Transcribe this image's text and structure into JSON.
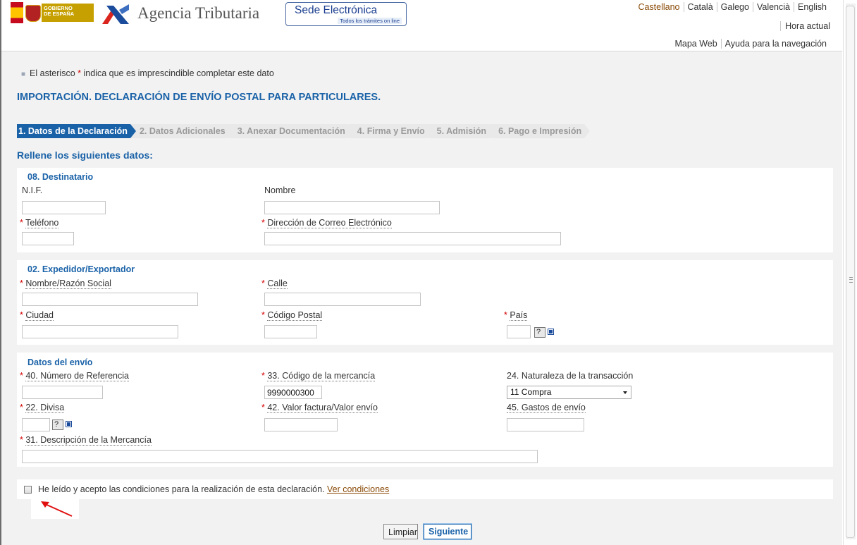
{
  "header": {
    "gov_logo_lines": [
      "GOBIERNO",
      "DE ESPAÑA"
    ],
    "agency_title": "Agencia Tributaria",
    "sede_title": "Sede Electrónica",
    "sede_subtitle": "Todos los trámites on line",
    "languages": [
      "Castellano",
      "Català",
      "Galego",
      "Valencià",
      "English"
    ],
    "hora_actual": "Hora actual",
    "mapa_web": "Mapa Web",
    "ayuda": "Ayuda para la navegación"
  },
  "note": {
    "prefix": "El asterisco",
    "star": "*",
    "suffix": "indica que es imprescindible completar este dato"
  },
  "page_title": "IMPORTACIÓN. DECLARACIÓN DE ENVÍO POSTAL PARA PARTICULARES.",
  "steps": [
    {
      "label": "1. Datos de la Declaración",
      "active": true
    },
    {
      "label": "2. Datos Adicionales",
      "active": false
    },
    {
      "label": "3. Anexar Documentación",
      "active": false
    },
    {
      "label": "4. Firma y Envío",
      "active": false
    },
    {
      "label": "5. Admisión",
      "active": false
    },
    {
      "label": "6. Pago e Impresión",
      "active": false
    }
  ],
  "subtitle": "Rellene los siguientes datos:",
  "destinatario": {
    "title": "08. Destinatario",
    "nif_label": "N.I.F.",
    "nombre_label": "Nombre",
    "telefono_label": "Teléfono",
    "email_label": "Dirección de Correo Electrónico"
  },
  "expedidor": {
    "title": "02. Expedidor/Exportador",
    "nombre_label": "Nombre/Razón Social",
    "calle_label": "Calle",
    "ciudad_label": "Ciudad",
    "cp_label": "Código Postal",
    "pais_label": "País",
    "help_text": "?"
  },
  "envio": {
    "title": "Datos del envío",
    "referencia_label": "40. Número de Referencia",
    "codigo_label": "33. Código de la mercancía",
    "codigo_value": "9990000300",
    "naturaleza_label": "24. Naturaleza de la transacción",
    "naturaleza_value": "11 Compra",
    "divisa_label": "22. Divisa",
    "valor_label": "42. Valor factura/Valor envío",
    "gastos_label": "45. Gastos de envío",
    "descripcion_label": "31. Descripción de la Mercancía",
    "help_text": "?"
  },
  "required_star": "*",
  "accept": {
    "text": "He leído y acepto las condiciones para la realización de esta declaración.",
    "link": "Ver condiciones",
    "checked": false
  },
  "buttons": {
    "clear": "Limpiar",
    "next": "Siguiente"
  },
  "colors": {
    "accent": "#1a62a8",
    "required": "#d40000",
    "link": "#8a4b08"
  }
}
